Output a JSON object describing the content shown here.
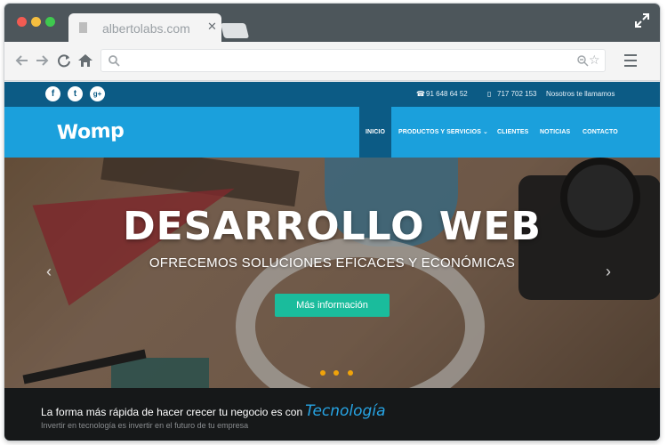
{
  "browser": {
    "tab_title": "albertolabs.com",
    "tab_close": "✕",
    "url": "",
    "window_controls": [
      "close-dot",
      "minimize-dot",
      "maximize-dot"
    ]
  },
  "topbar": {
    "social": [
      {
        "name": "facebook-icon",
        "glyph": "f"
      },
      {
        "name": "twitter-icon",
        "glyph": "t"
      },
      {
        "name": "google-plus-icon",
        "glyph": "g+"
      }
    ],
    "phone_1": "91 648 64 52",
    "phone_2": "717 702 153",
    "callback": "Nosotros te llamamos"
  },
  "header": {
    "logo": "Womp",
    "menu": [
      {
        "label": "INICIO",
        "active": true
      },
      {
        "label": "PRODUCTOS Y SERVICIOS ⌄",
        "active": false
      },
      {
        "label": "CLIENTES",
        "active": false
      },
      {
        "label": "NOTICIAS",
        "active": false
      },
      {
        "label": "CONTACTO",
        "active": false
      }
    ]
  },
  "hero": {
    "title": "DESARROLLO WEB",
    "subtitle": "OFRECEMOS SOLUCIONES EFICACES Y ECONÓMICAS",
    "cta": "Más información",
    "prev_arrow": "‹",
    "next_arrow": "›",
    "slides": 3
  },
  "tagline": {
    "main": "La forma más rápida de hacer crecer tu negocio es con",
    "highlight": "Tecnología",
    "sub": "Invertir en tecnología es invertir en el futuro de tu empresa"
  },
  "colors": {
    "topbar": "#0c5b85",
    "header": "#1ba0dc",
    "cta": "#1abc9c",
    "highlight": "#27a4e4",
    "slider_dots": "#f0a30a"
  }
}
